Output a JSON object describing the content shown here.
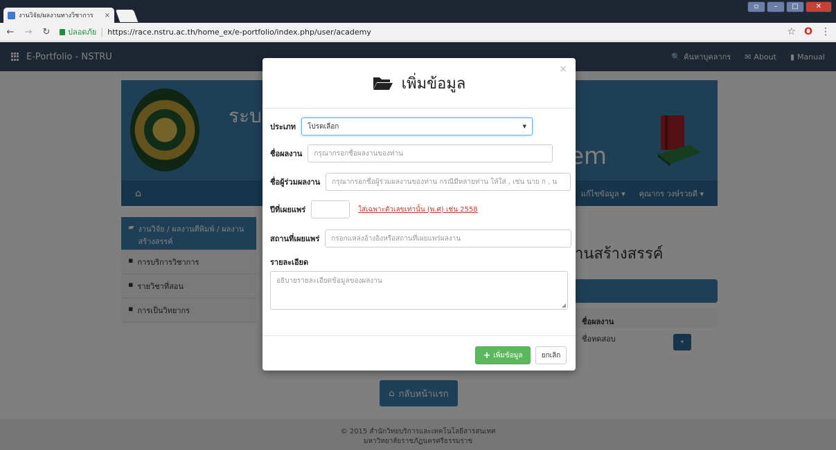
{
  "browser": {
    "tab_title": "งานวิจัย/ผลงานทางวิชาการ",
    "tab_close": "×",
    "secure_label": "ปลอดภัย",
    "url": "https://race.nstru.ac.th/home_ex/e-portfolio/index.php/user/academy"
  },
  "site": {
    "brand": "E-Portfolio - NSTRU",
    "top_links": [
      "ค้นหาบุคลากร",
      "About",
      "Manual"
    ],
    "banner_text_left": "ระบ",
    "banner_text_right": "em",
    "mainnav_right": [
      "แก้ไขข้อมูล",
      "คุณากร วงษ์รวยดี"
    ],
    "sidebar": [
      "งานวิจัย / ผลงานตีพิมพ์ / ผลงานสร้างสรรค์",
      "การบริการวิชาการ",
      "รายวิชาที่สอน",
      "การเป็นวิทยากร"
    ],
    "content_title": "านสร้างสรรค์",
    "content_col_header": "ชื่อผลงาน",
    "content_row": "ชื่อทดสอบ",
    "home_button": "กลับหน้าแรก",
    "footer_line1": "© 2015 สำนักวิทยบริการและเทคโนโลยีสารสนเทศ",
    "footer_line2": "มหาวิทยาลัยราชภัฏนครศรีธรรมราช"
  },
  "modal": {
    "title": "เพิ่มข้อมูล",
    "close": "×",
    "type_label": "ประเภท",
    "type_value": "โปรดเลือก",
    "name_label": "ชื่อผลงาน",
    "name_placeholder": "กรุณากรอกชื่อผลงานของท่าน",
    "coauthor_label": "ชื่อผู้ร่วมผลงาน",
    "coauthor_placeholder": "กรุณากรอกชื่อผู้ร่วมผลงานของท่าน กรณีมีหลายท่าน ให้ใส่ , เช่น นาย ก , น",
    "year_label": "ปีที่เผยแพร่",
    "year_value": "",
    "year_hint": "ใส่เฉพาะตัวเลขเท่านั้น (พ.ศ) เช่น 2558",
    "place_label": "สถานที่เผยแพร่",
    "place_placeholder": "กรอกแหล่งอ้างอิงหรือสถานที่เผยแพร่ผลงาน",
    "detail_label": "รายละเอียด",
    "detail_placeholder": "อธิบายรายละเอียดข้อมูลของผลงาน",
    "submit_label": "เพิ่มข้อมูล",
    "cancel_label": "ยกเลิก"
  },
  "colors": {
    "accent": "#3e7fae",
    "success": "#5cb85c",
    "topnav": "#3a4e66",
    "hint": "#c0392b"
  }
}
